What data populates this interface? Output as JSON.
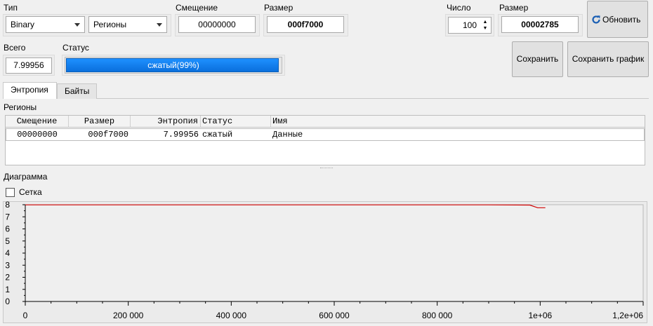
{
  "type": {
    "label": "Тип",
    "value": "Binary"
  },
  "mode": {
    "value": "Регионы"
  },
  "offset": {
    "label": "Смещение",
    "value": "00000000"
  },
  "size": {
    "label": "Размер",
    "value": "000f7000"
  },
  "count": {
    "label": "Число",
    "value": "100"
  },
  "block_size": {
    "label": "Размер",
    "value": "00002785"
  },
  "refresh_button": {
    "label": "Обновить"
  },
  "total": {
    "label": "Всего",
    "value": "7.99956"
  },
  "status": {
    "label": "Статус",
    "text": "сжатый(99%)",
    "progress": 0.99
  },
  "save_button": {
    "label": "Сохранить"
  },
  "save_chart_button": {
    "label": "Сохранить график"
  },
  "tabs": [
    {
      "label": "Энтропия",
      "active": true
    },
    {
      "label": "Байты",
      "active": false
    }
  ],
  "regions": {
    "title": "Регионы",
    "columns": [
      "Смещение",
      "Размер",
      "Энтропия",
      "Статус",
      "Имя"
    ],
    "rows": [
      {
        "offset": "00000000",
        "size": "000f7000",
        "entropy": "7.99956",
        "status": "сжатый",
        "name": "Данные"
      }
    ]
  },
  "diagram": {
    "title": "Диаграмма",
    "grid_label": "Сетка",
    "grid_checked": false
  },
  "chart_data": {
    "type": "line",
    "xlim": [
      0,
      1200000
    ],
    "ylim": [
      0,
      8
    ],
    "x_ticks": [
      "0",
      "200 000",
      "400 000",
      "600 000",
      "800 000",
      "1e+06",
      "1,2e+06"
    ],
    "y_ticks": [
      "0",
      "1",
      "2",
      "3",
      "4",
      "5",
      "6",
      "7",
      "8"
    ],
    "grid": false,
    "colors": {
      "series": "#d00000"
    },
    "series": [
      {
        "x": [
          0,
          100000,
          200000,
          300000,
          400000,
          500000,
          600000,
          700000,
          800000,
          900000,
          980000,
          995000,
          1010000
        ],
        "y": [
          7.99,
          7.99,
          7.99,
          7.99,
          7.99,
          7.99,
          7.99,
          7.99,
          7.99,
          7.99,
          7.97,
          7.75,
          7.75
        ]
      }
    ]
  }
}
